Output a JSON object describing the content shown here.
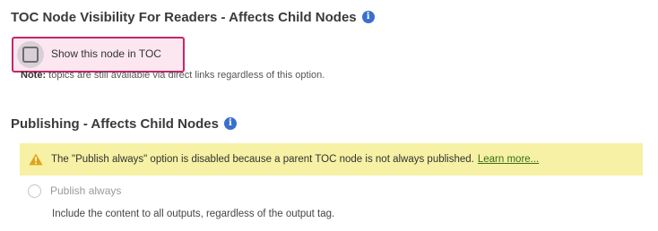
{
  "colors": {
    "info_icon": "#3a6fcf",
    "highlight_border": "#c4276a",
    "highlight_fill": "#fce7f0",
    "warning_background": "#f6f1a4",
    "warning_icon": "#e0a516",
    "link": "#3a6e16"
  },
  "toc_section": {
    "title": "TOC Node Visibility For Readers - Affects Child Nodes",
    "info_icon": "info-circle",
    "checkbox": {
      "label": "Show this node in TOC",
      "checked": false
    },
    "note_label": "Note:",
    "note_text": " topics are still available via direct links regardless of this option."
  },
  "publishing_section": {
    "title": "Publishing - Affects Child Nodes",
    "info_icon": "info-circle",
    "warning": {
      "icon": "warning-triangle",
      "text": "The \"Publish always\" option is disabled because a parent TOC node is not always published.",
      "link_text": "Learn more..."
    },
    "radio": {
      "label": "Publish always",
      "selected": false,
      "disabled": true,
      "description": "Include the content to all outputs, regardless of the output tag."
    }
  }
}
